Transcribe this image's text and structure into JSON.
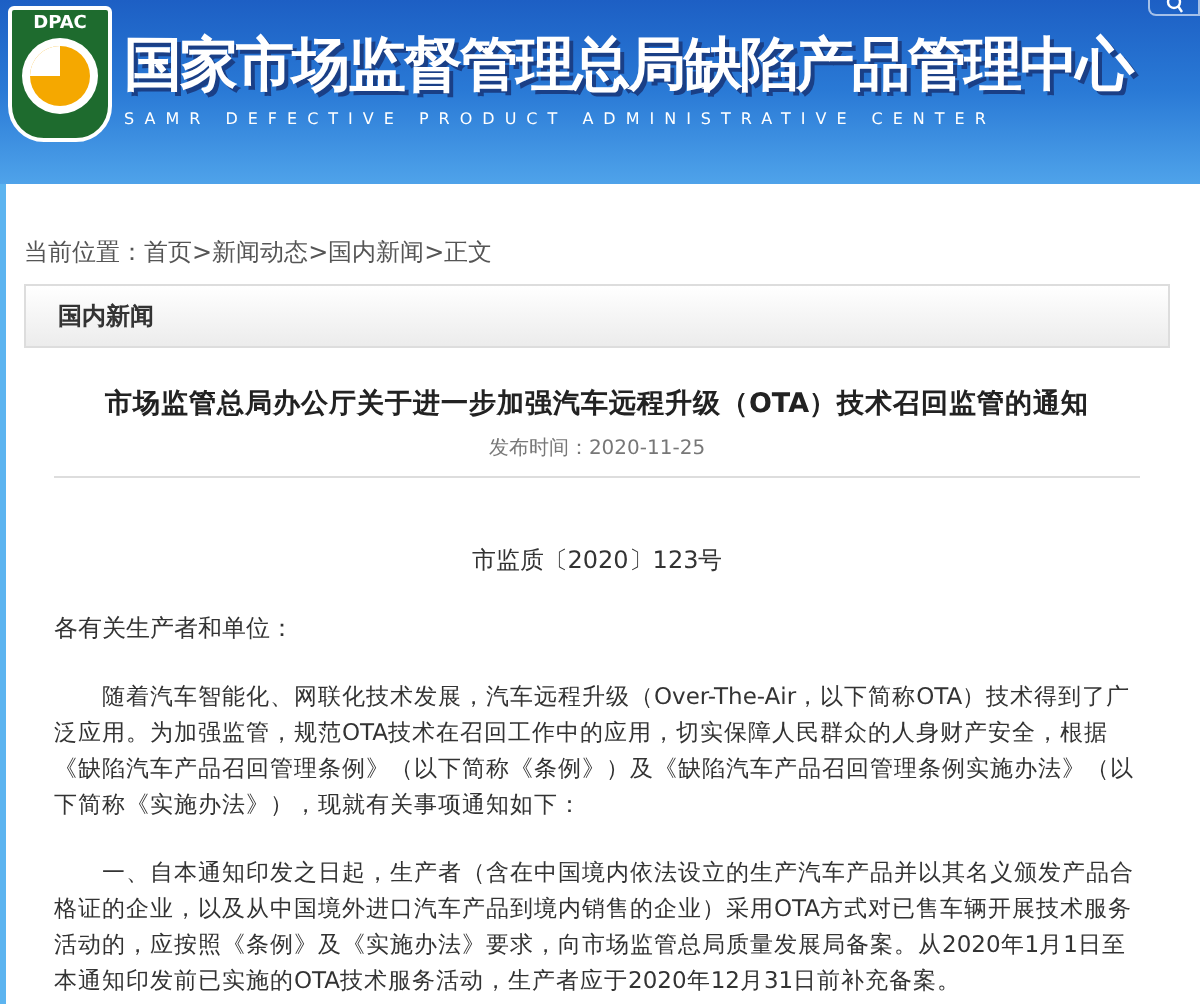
{
  "header": {
    "logo_text": "DPAC",
    "title": "国家市场监督管理总局缺陷产品管理中心",
    "subtitle": "SAMR DEFECTIVE PRODUCT ADMINISTRATIVE CENTER"
  },
  "breadcrumb": {
    "label": "当前位置：",
    "items": [
      "首页",
      "新闻动态",
      "国内新闻",
      "正文"
    ],
    "separator": ">"
  },
  "section": {
    "title": "国内新闻"
  },
  "article": {
    "title": "市场监管总局办公厅关于进一步加强汽车远程升级（OTA）技术召回监管的通知",
    "date": "发布时间：2020-11-25",
    "doc_number": "市监质〔2020〕123号",
    "salutation": "各有关生产者和单位：",
    "paragraphs": [
      "随着汽车智能化、网联化技术发展，汽车远程升级（Over-The-Air，以下简称OTA）技术得到了广泛应用。为加强监管，规范OTA技术在召回工作中的应用，切实保障人民群众的人身财产安全，根据《缺陷汽车产品召回管理条例》（以下简称《条例》）及《缺陷汽车产品召回管理条例实施办法》（以下简称《实施办法》），现就有关事项通知如下：",
      "一、自本通知印发之日起，生产者（含在中国境内依法设立的生产汽车产品并以其名义颁发产品合格证的企业，以及从中国境外进口汽车产品到境内销售的企业）采用OTA方式对已售车辆开展技术服务活动的，应按照《条例》及《实施办法》要求，向市场监管总局质量发展局备案。从2020年1月1日至本通知印发前已实施的OTA技术服务活动，生产者应于2020年12月31日前补充备案。"
    ]
  }
}
